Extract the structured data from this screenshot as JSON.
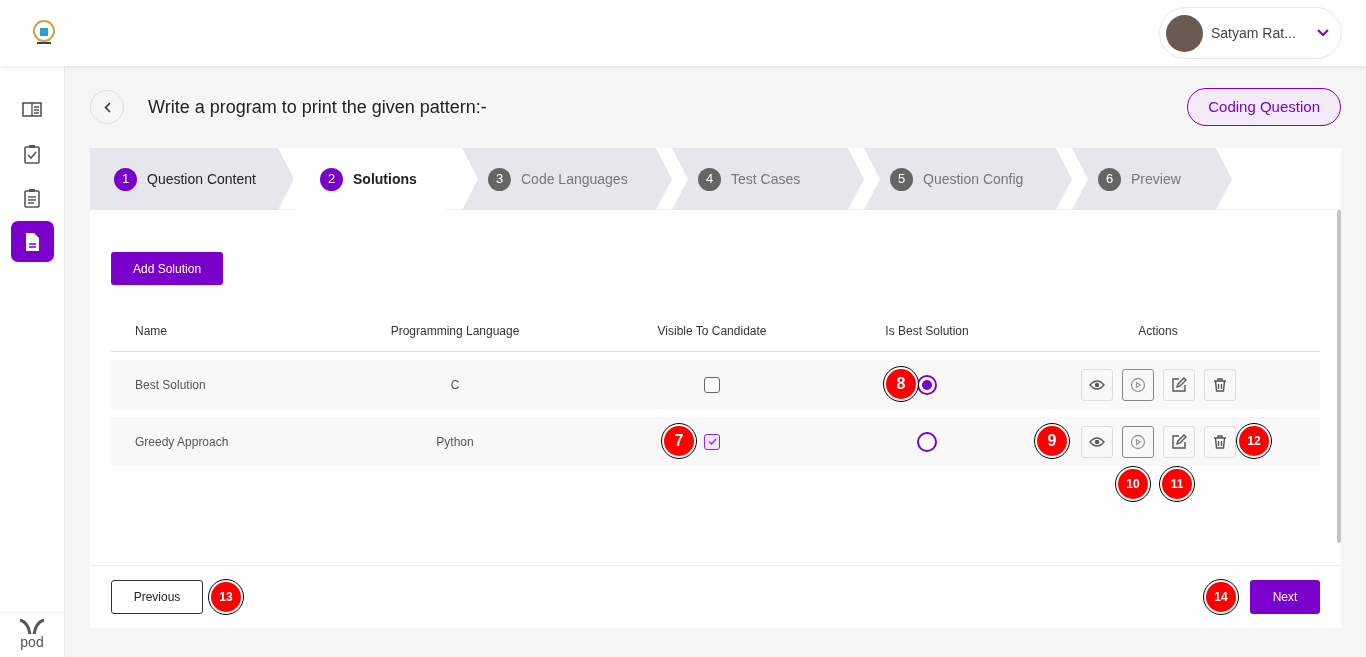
{
  "header": {
    "user_name": "Satyam Rat..."
  },
  "sidebar": {
    "items": [
      {
        "selected": false
      },
      {
        "selected": false
      },
      {
        "selected": false
      },
      {
        "selected": true
      }
    ],
    "footer_logo_text": "pod"
  },
  "page": {
    "title": "Write a program to print the given pattern:-",
    "type_badge": "Coding Question"
  },
  "steps": [
    {
      "number": "1",
      "label": "Question Content",
      "completed": true,
      "selected": false
    },
    {
      "number": "2",
      "label": "Solutions",
      "completed": true,
      "selected": true
    },
    {
      "number": "3",
      "label": "Code Languages",
      "completed": false,
      "selected": false
    },
    {
      "number": "4",
      "label": "Test Cases",
      "completed": false,
      "selected": false
    },
    {
      "number": "5",
      "label": "Question Config",
      "completed": false,
      "selected": false
    },
    {
      "number": "6",
      "label": "Preview",
      "completed": false,
      "selected": false
    }
  ],
  "add_button": "Add Solution",
  "table": {
    "columns": [
      "Name",
      "Programming Language",
      "Visible To Candidate",
      "Is Best Solution",
      "Actions"
    ],
    "rows": [
      {
        "name": "Best Solution",
        "language": "C",
        "visible": false,
        "best": true,
        "callouts": {
          "best": "8"
        }
      },
      {
        "name": "Greedy Approach",
        "language": "Python",
        "visible": true,
        "best": false,
        "callouts": {
          "visible": "7",
          "view": "9",
          "run": "10",
          "edit": "11",
          "delete": "12"
        }
      }
    ]
  },
  "footer": {
    "previous": {
      "label": "Previous",
      "callout": "13"
    },
    "next": {
      "label": "Next",
      "callout": "14"
    }
  }
}
